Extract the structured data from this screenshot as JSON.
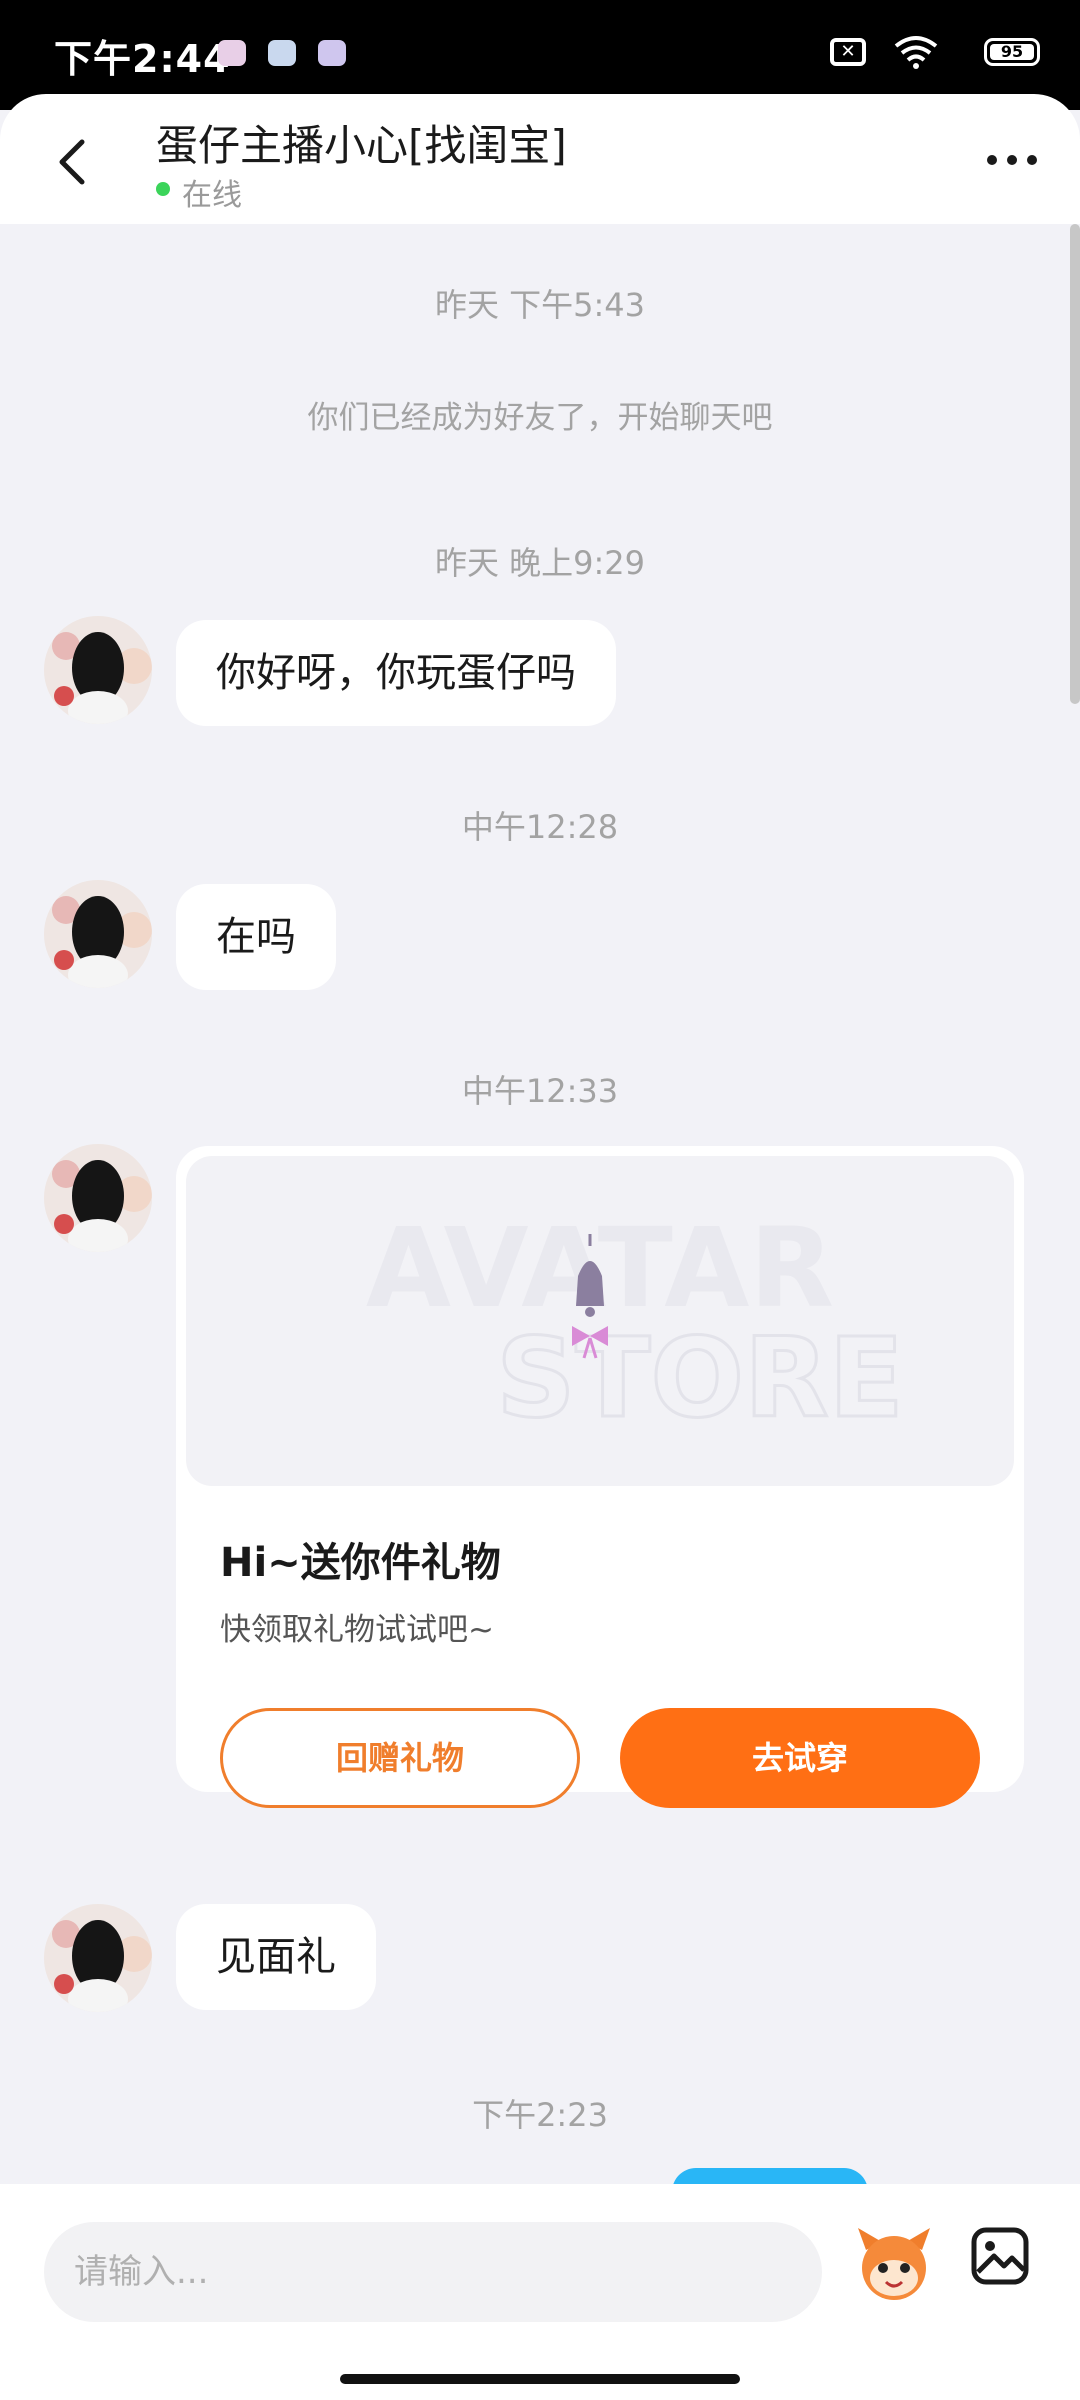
{
  "status_bar": {
    "time": "下午2:44",
    "battery": "95"
  },
  "header": {
    "title": "蛋仔主播小心[找闺宝]",
    "presence": "在线"
  },
  "chat": {
    "items": [
      {
        "type": "timestamp",
        "text": "昨天 下午5:43"
      },
      {
        "type": "system",
        "text": "你们已经成为好友了，开始聊天吧"
      },
      {
        "type": "timestamp",
        "text": "昨天 晚上9:29"
      },
      {
        "type": "message",
        "text": "你好呀，你玩蛋仔吗"
      },
      {
        "type": "timestamp",
        "text": "中午12:28"
      },
      {
        "type": "message",
        "text": "在吗"
      },
      {
        "type": "timestamp",
        "text": "中午12:33"
      },
      {
        "type": "timestamp",
        "text": "下午2:23"
      },
      {
        "type": "message",
        "text": "见面礼"
      }
    ],
    "gift_card": {
      "watermark_line1": "AVATAR",
      "watermark_line2": "STORE",
      "title": "Hi~送你件礼物",
      "subtitle": "快领取礼物试试吧~",
      "return_gift_label": "回赠礼物",
      "try_on_label": "去试穿"
    }
  },
  "input": {
    "placeholder": "请输入..."
  },
  "colors": {
    "accent_orange": "#ff6f14",
    "online_green": "#3bd45a",
    "outgoing_blue": "#29b6f6"
  }
}
